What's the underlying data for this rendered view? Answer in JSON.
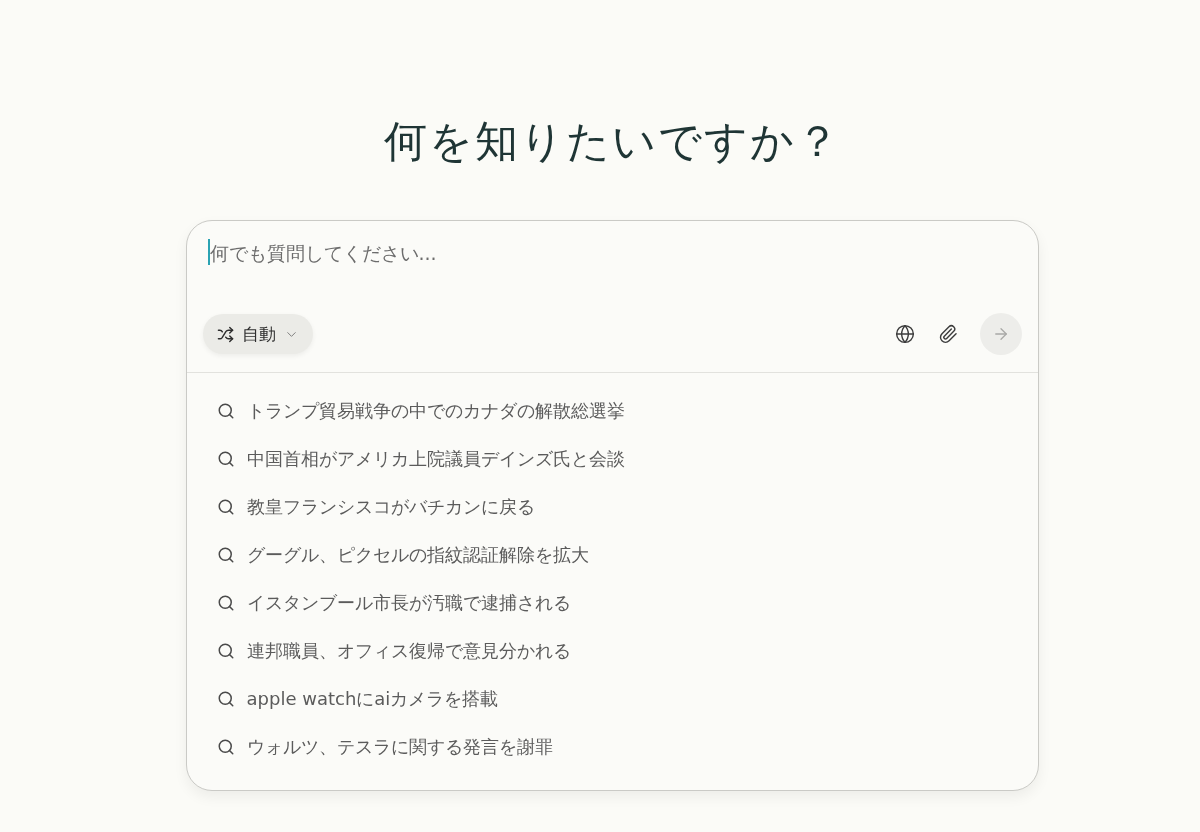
{
  "heading": "何を知りたいですか？",
  "search": {
    "placeholder": "何でも質問してください...",
    "focused": true
  },
  "mode_button": {
    "label": "自動"
  },
  "send_button": {
    "disabled": true
  },
  "suggestions": [
    "トランプ貿易戦争の中でのカナダの解散総選挙",
    "中国首相がアメリカ上院議員デインズ氏と会談",
    "教皇フランシスコがバチカンに戻る",
    "グーグル、ピクセルの指紋認証解除を拡大",
    "イスタンブール市長が汚職で逮捕される",
    "連邦職員、オフィス復帰で意見分かれる",
    "apple watchにaiカメラを搭載",
    "ウォルツ、テスラに関する発言を謝罪"
  ]
}
